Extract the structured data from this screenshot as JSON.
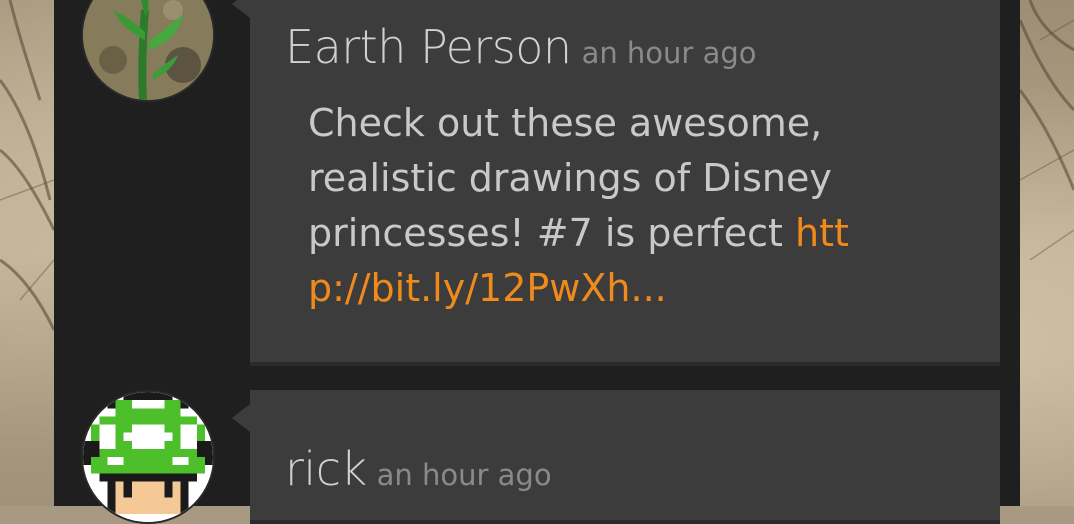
{
  "feed": {
    "posts": [
      {
        "author": "Earth Person",
        "time": "an hour ago",
        "text": "Check out these awesome, realistic drawings of Disney princesses! #7 is perfect ",
        "link": "http://bit.ly/12PwXh..."
      },
      {
        "author": "rick",
        "time": "an hour ago"
      }
    ]
  },
  "colors": {
    "card": "#3c3c3c",
    "column": "#1f1f1f",
    "link": "#f08a1c",
    "author_text": "#d0d0d0",
    "time_text": "#8a8a8a"
  },
  "icons": {
    "avatar1": "plant-sprout-photo",
    "avatar2": "pixel-mushroom-1up"
  }
}
